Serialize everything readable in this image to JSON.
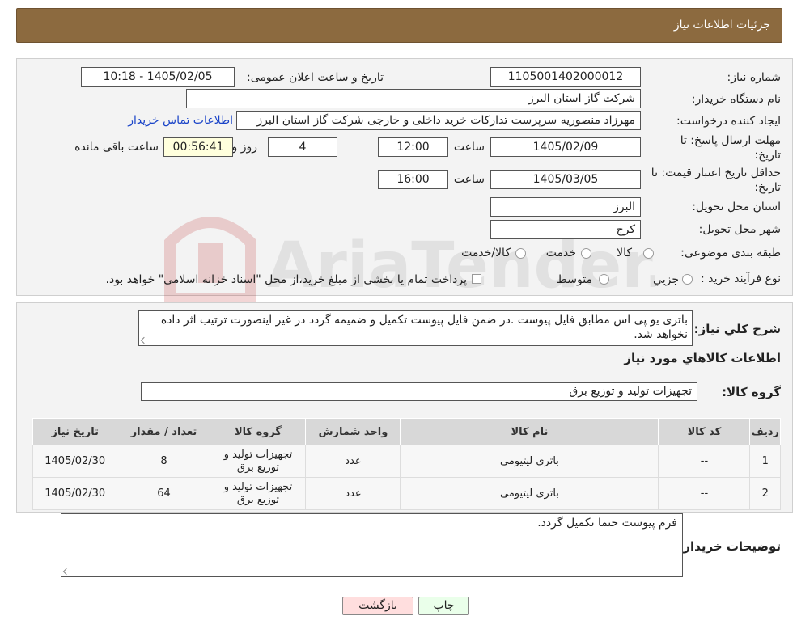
{
  "header": {
    "title": "جزئیات اطلاعات نیاز"
  },
  "form": {
    "need_number_label": "شماره نیاز:",
    "need_number_value": "1105001402000012",
    "announce_label": "تاریخ و ساعت اعلان عمومی:",
    "announce_value": "1405/02/05 - 10:18",
    "buyer_org_label": "نام دستگاه خریدار:",
    "buyer_org_value": "شرکت گاز استان البرز",
    "requester_label": "ایجاد کننده درخواست:",
    "requester_value": "مهرزاد منصوریه سرپرست تدارکات خرید داخلی و خارجی شرکت گاز استان البرز",
    "contact_link": "اطلاعات تماس خریدار",
    "deadline_label_1": "مهلت ارسال پاسخ: تا",
    "deadline_label_2": "تاریخ:",
    "deadline_date": "1405/02/09",
    "time_label": "ساعت",
    "deadline_time": "12:00",
    "days_value": "4",
    "days_label": "روز و",
    "remaining_time": "00:56:41",
    "remaining_label": "ساعت باقی مانده",
    "validity_label_1": "حداقل تاریخ اعتبار قیمت: تا",
    "validity_label_2": "تاریخ:",
    "validity_date": "1405/03/05",
    "validity_time": "16:00",
    "province_label": "استان محل تحویل:",
    "province_value": "البرز",
    "city_label": "شهر محل تحویل:",
    "city_value": "کرج",
    "category_label": "طبقه بندی موضوعی:",
    "category_options": [
      "کالا",
      "خدمت",
      "کالا/خدمت"
    ],
    "purchase_type_label": "نوع فرآیند خرید :",
    "purchase_options": [
      "جزیي",
      "متوسط"
    ],
    "purchase_note": "پرداخت تمام یا بخشی از مبلغ خرید،از محل \"اسناد خزانه اسلامی\" خواهد بود."
  },
  "watermark": {
    "text": "AriaTender.neT"
  },
  "description": {
    "label": "شرح کلي نياز:",
    "value": "باتری یو پی اس مطابق فایل پیوست .در ضمن فایل پیوست تکمیل و ضمیمه گردد در غیر اینصورت ترتیب اثر داده نخواهد شد."
  },
  "goods": {
    "section_title": "اطلاعات کالاهاي مورد نياز",
    "group_label": "گروه کالا:",
    "group_value": "تجهیزات تولید و توزیع برق",
    "columns": [
      "رديف",
      "کد کالا",
      "نام کالا",
      "واحد شمارش",
      "گروه کالا",
      "تعداد / مقدار",
      "تاريخ نياز"
    ],
    "rows": [
      {
        "index": "1",
        "code": "--",
        "name": "باتری لیتیومی",
        "unit": "عدد",
        "group": "تجهیزات تولید و توزیع برق",
        "qty": "8",
        "date": "1405/02/30"
      },
      {
        "index": "2",
        "code": "--",
        "name": "باتری لیتیومی",
        "unit": "عدد",
        "group": "تجهیزات تولید و توزیع برق",
        "qty": "64",
        "date": "1405/02/30"
      }
    ]
  },
  "buyer_notes": {
    "label": "توضيحات خريدار:",
    "value": "فرم پیوست حتما تکمیل گردد."
  },
  "buttons": {
    "print": "چاپ",
    "back": "بازگشت"
  }
}
